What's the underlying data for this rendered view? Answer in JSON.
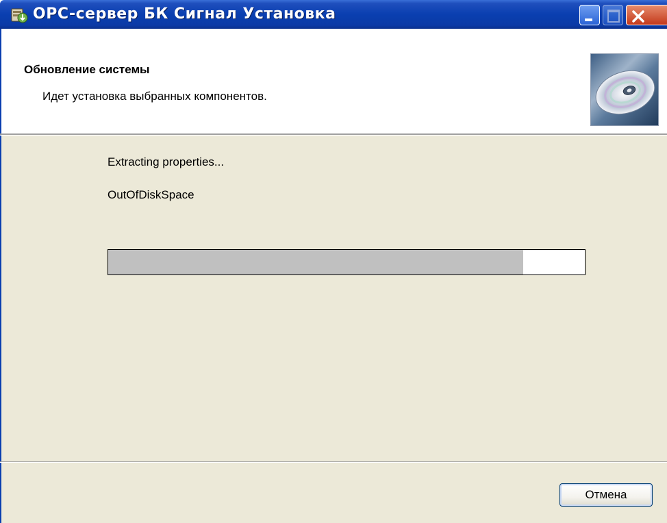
{
  "window": {
    "title": "OPC-сервер БК Сигнал Установка",
    "icon": "installer-icon",
    "controls": {
      "minimize": "minimize-icon",
      "maximize": "maximize-icon",
      "close": "close-icon"
    }
  },
  "header": {
    "title": "Обновление системы",
    "subtitle": "Идет установка выбранных компонентов.",
    "icon": "cd-disc-icon"
  },
  "body": {
    "status_line_1": "Extracting properties...",
    "status_line_2": "OutOfDiskSpace",
    "progress": 0.87
  },
  "footer": {
    "cancel_label": "Отмена"
  },
  "colors": {
    "titlebar": "#0a3fb0",
    "dialog_background": "#ece9d8",
    "progress_fill": "#c0c0c0",
    "close_button": "#c4391b"
  }
}
